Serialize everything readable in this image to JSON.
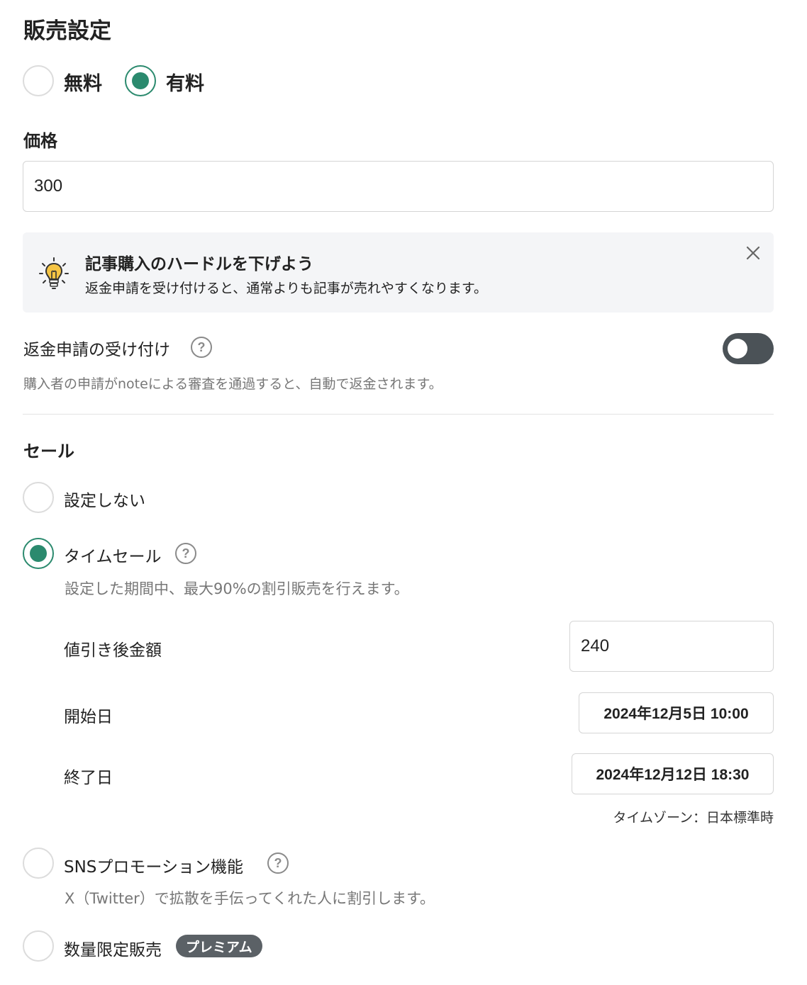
{
  "sales_settings": {
    "title": "販売設定",
    "pricing_options": {
      "free": "無料",
      "paid": "有料",
      "selected": "paid"
    },
    "price": {
      "label": "価格",
      "value": "300"
    },
    "tip": {
      "title": "記事購入のハードルを下げよう",
      "body": "返金申請を受け付けると、通常よりも記事が売れやすくなります。",
      "icon": "lightbulb-icon"
    },
    "refund": {
      "label": "返金申請の受け付け",
      "description": "購入者の申請がnoteによる審査を通過すると、自動で返金されます。",
      "enabled": false
    }
  },
  "sale": {
    "title": "セール",
    "options": {
      "none": "設定しない",
      "time_sale": {
        "label": "タイムセール",
        "description": "設定した期間中、最大90%の割引販売を行えます。",
        "discount_price_label": "値引き後金額",
        "discount_price_value": "240",
        "start_label": "開始日",
        "start_value": "2024年12月5日 10:00",
        "end_label": "終了日",
        "end_value": "2024年12月12日 18:30",
        "timezone": "タイムゾーン：日本標準時"
      },
      "sns_promotion": {
        "label": "SNSプロモーション機能",
        "description": "X（Twitter）で拡散を手伝ってくれた人に割引します。"
      },
      "limited_quantity": {
        "label": "数量限定販売",
        "badge": "プレミアム"
      }
    },
    "selected": "time_sale"
  },
  "help_glyph": "?",
  "colors": {
    "accent": "#2b8a6e",
    "toggle_off": "#4b5257",
    "tip_bg": "#f4f5f7"
  }
}
